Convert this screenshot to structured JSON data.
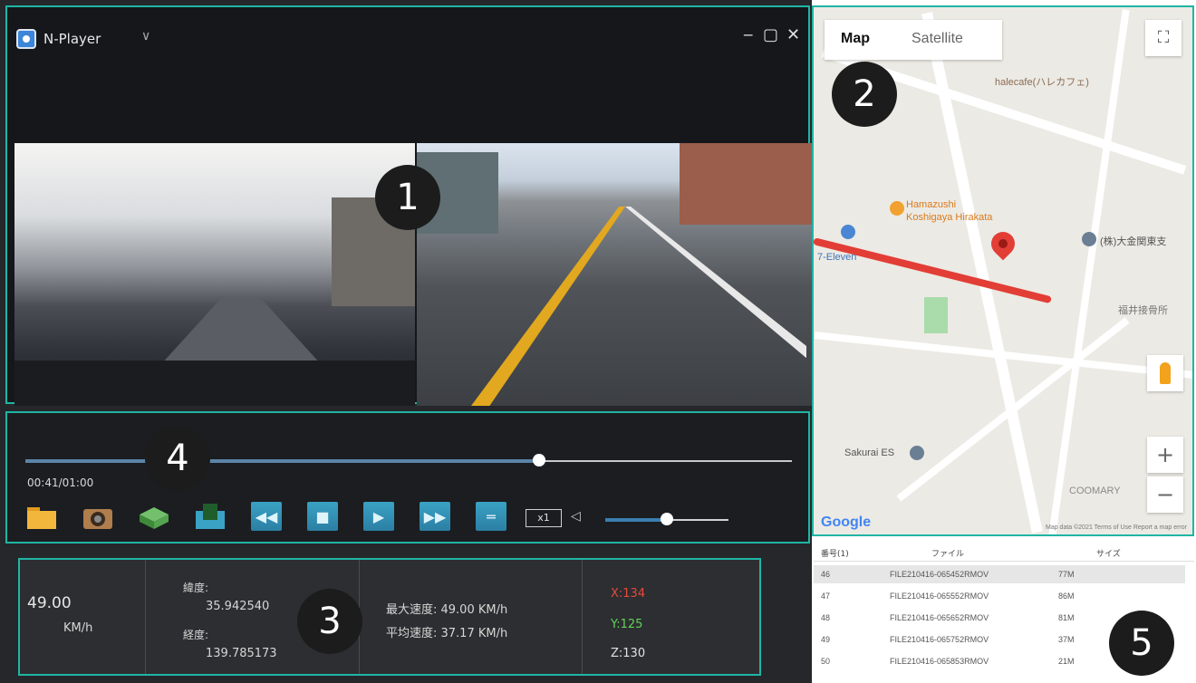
{
  "app": {
    "title": "N-Player",
    "chevron": "∨"
  },
  "window": {
    "minimize": "‒",
    "restore": "▢",
    "close": "✕"
  },
  "badges": {
    "b1": "1",
    "b2": "2",
    "b3": "3",
    "b4": "4",
    "b5": "5"
  },
  "player": {
    "time": "00:41/01:00",
    "progress_fraction": 0.67,
    "speed_label": "x1",
    "volume_fraction": 0.5
  },
  "info": {
    "speed_value": "49.00",
    "speed_unit": "KM/h",
    "lat_label": "緯度:",
    "lat_value": "35.942540",
    "lon_label": "経度:",
    "lon_value": "139.785173",
    "max_speed": "最大速度: 49.00 KM/h",
    "avg_speed": "平均速度: 37.17 KM/h",
    "g_x": "X:134",
    "g_y": "Y:125",
    "g_z": "Z:130"
  },
  "map": {
    "tab_map": "Map",
    "tab_satellite": "Satellite",
    "poi_hamazushi": "Hamazushi",
    "poi_hamazushi2": "Koshigaya Hirakata",
    "poi_cafe": "halecafe(ハレカフェ)",
    "poi_711": "7-Eleven",
    "poi_sakurai": "Sakurai ES",
    "poi_kk": "(株)大金関東支",
    "poi_fukui": "福井接骨所",
    "poi_coomary": "COOMARY",
    "zoom_in": "+",
    "zoom_out": "−",
    "google": "Google",
    "footer": "Map data ©2021   Terms of Use   Report a map error"
  },
  "files": {
    "headers": [
      "番号(1)",
      "ファイル",
      "サイズ"
    ],
    "rows": [
      {
        "num": "46",
        "name": "FILE210416-065452RMOV",
        "size": "77M"
      },
      {
        "num": "47",
        "name": "FILE210416-065552RMOV",
        "size": "86M"
      },
      {
        "num": "48",
        "name": "FILE210416-065652RMOV",
        "size": "81M"
      },
      {
        "num": "49",
        "name": "FILE210416-065752RMOV",
        "size": "37M"
      },
      {
        "num": "50",
        "name": "FILE210416-065853RMOV",
        "size": "21M"
      }
    ]
  },
  "colors": {
    "accent": "#1fb5a4",
    "route": "#e23e36",
    "button": "#2b7fa3"
  }
}
